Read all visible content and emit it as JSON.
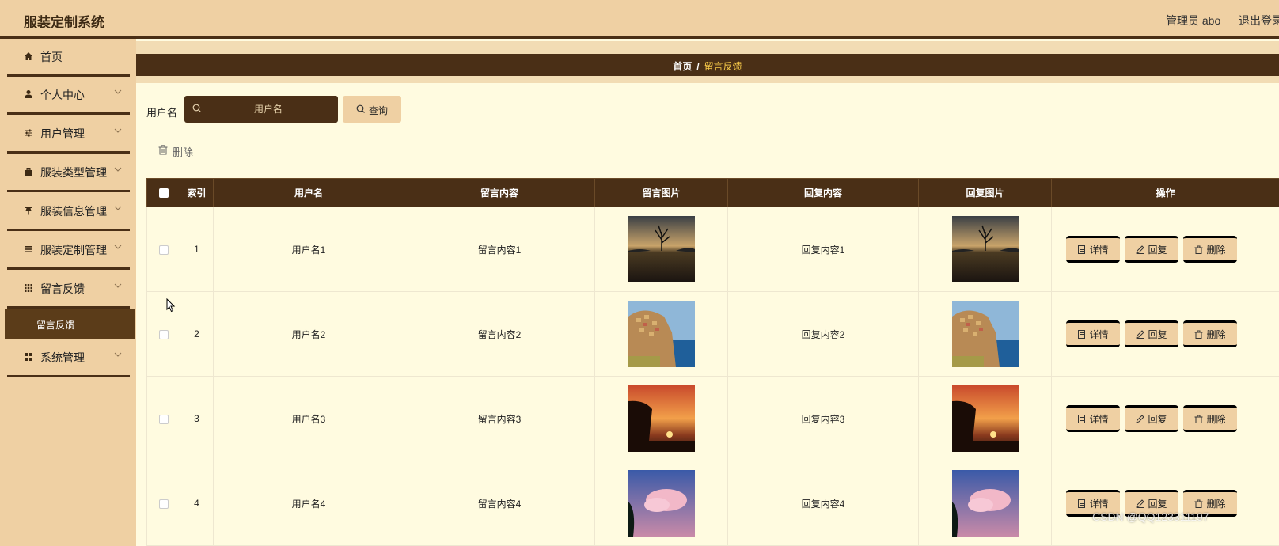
{
  "header": {
    "title": "服装定制系统",
    "user": "管理员 abo",
    "logout": "退出登录"
  },
  "sidebar": {
    "items": [
      {
        "label": "首页",
        "icon": "home-icon",
        "has_children": false
      },
      {
        "label": "个人中心",
        "icon": "user-icon",
        "has_children": true
      },
      {
        "label": "用户管理",
        "icon": "sliders-icon",
        "has_children": true
      },
      {
        "label": "服装类型管理",
        "icon": "briefcase-icon",
        "has_children": true
      },
      {
        "label": "服装信息管理",
        "icon": "pin-icon",
        "has_children": true
      },
      {
        "label": "服装定制管理",
        "icon": "list-icon",
        "has_children": true
      },
      {
        "label": "留言反馈",
        "icon": "grid-icon",
        "has_children": true
      },
      {
        "label": "系统管理",
        "icon": "apps-icon",
        "has_children": true
      }
    ],
    "active_submenu": "留言反馈"
  },
  "breadcrumb": {
    "home": "首页",
    "separator": "/",
    "current": "留言反馈"
  },
  "search": {
    "label": "用户名",
    "placeholder": "用户名",
    "value": "",
    "button": "查询"
  },
  "toolbar": {
    "delete_label": "删除"
  },
  "table": {
    "columns": [
      "索引",
      "用户名",
      "留言内容",
      "留言图片",
      "回复内容",
      "回复图片",
      "操作"
    ],
    "rows": [
      {
        "index": "1",
        "username": "用户名1",
        "content": "留言内容1",
        "image": "lone-tree-lake",
        "reply": "回复内容1",
        "reply_image": "lone-tree-lake"
      },
      {
        "index": "2",
        "username": "用户名2",
        "content": "留言内容2",
        "image": "cliff-village",
        "reply": "回复内容2",
        "reply_image": "cliff-village"
      },
      {
        "index": "3",
        "username": "用户名3",
        "content": "留言内容3",
        "image": "sunset-tree",
        "reply": "回复内容3",
        "reply_image": "sunset-tree"
      },
      {
        "index": "4",
        "username": "用户名4",
        "content": "留言内容4",
        "image": "pink-cloud-sky",
        "reply": "回复内容4",
        "reply_image": "pink-cloud-sky"
      }
    ],
    "actions": {
      "detail": "详情",
      "reply": "回复",
      "delete": "删除"
    }
  },
  "watermark": "CSDN @QQ123311197",
  "colors": {
    "header_bg": "#efd0a3",
    "dark_brown": "#4a2f16",
    "page_bg": "#fffbe0",
    "breadcrumb_active": "#f7c948",
    "active_submenu": "#5b3c19"
  }
}
